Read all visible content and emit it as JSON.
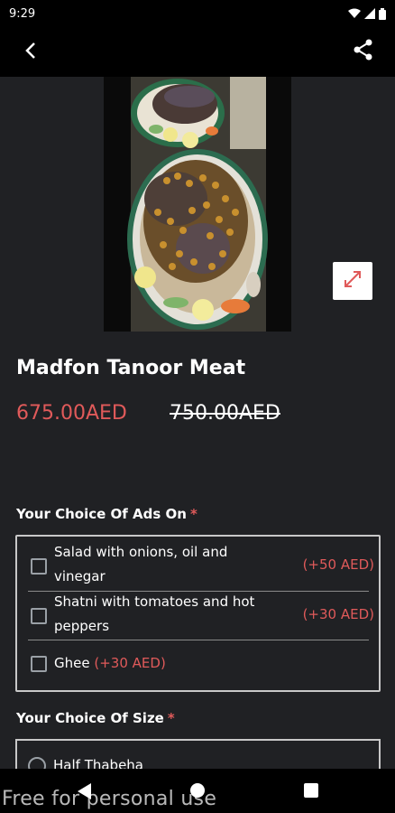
{
  "status_bar": {
    "time": "9:29",
    "icons": [
      "wifi-icon",
      "signal-icon",
      "battery-icon"
    ]
  },
  "app_bar": {
    "back_icon": "arrow-left-icon",
    "share_icon": "share-icon"
  },
  "product": {
    "title": "Madfon Tanoor Meat",
    "price_now": "675.00AED",
    "price_old": "750.00AED",
    "expand_icon": "expand-arrows-icon"
  },
  "addons": {
    "label": "Your Choice Of Ads On",
    "required_mark": "*",
    "options": [
      {
        "label_line1": "Salad with onions, oil and",
        "label_line2": "vinegar",
        "price": "(+50 AED)",
        "checked": false
      },
      {
        "label_line1": "Shatni with tomatoes and hot",
        "label_line2": "peppers",
        "price": "(+30 AED)",
        "checked": false
      },
      {
        "label_line1": "Ghee",
        "label_line2": "",
        "price": "(+30 AED)",
        "checked": false
      }
    ]
  },
  "size": {
    "label": "Your Choice Of Size",
    "required_mark": "*",
    "options": [
      {
        "label": "Half Thabeha",
        "selected": false
      }
    ]
  },
  "watermark": "Free for personal use",
  "colors": {
    "accent": "#e05a5a",
    "background": "#202124",
    "bar": "#000000"
  }
}
